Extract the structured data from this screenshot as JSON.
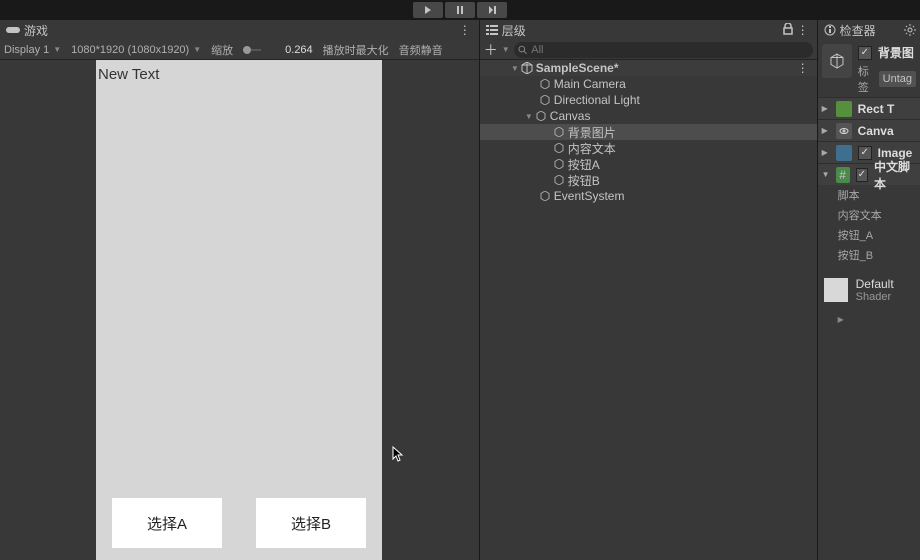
{
  "topbar": {},
  "game": {
    "tab_label": "游戏",
    "display_label": "Display 1",
    "resolution": "1080*1920 (1080x1920)",
    "zoom_label": "缩放",
    "zoom_value": "0.264",
    "maximize_label": "播放时最大化",
    "audio_label": "音频静音",
    "viewport": {
      "new_text": "New Text",
      "button_a": "选择A",
      "button_b": "选择B"
    }
  },
  "hierarchy": {
    "tab_label": "层级",
    "search_placeholder": "All",
    "scene": "SampleScene*",
    "items": [
      "Main Camera",
      "Directional Light",
      "Canvas",
      "背景图片",
      "内容文本",
      "按钮A",
      "按钮B",
      "EventSystem"
    ]
  },
  "inspector": {
    "tab_label": "检查器",
    "obj_name": "背景图",
    "tag_label": "标签",
    "tag_value": "Untag",
    "components": {
      "rect": "Rect T",
      "canvas": "Canva",
      "image": "Image",
      "script": "中文脚本"
    },
    "fields": {
      "script": "脚本",
      "content_text": "内容文本",
      "btn_a": "按钮_A",
      "btn_b": "按钮_B"
    },
    "material": {
      "name": "Default",
      "shader": "Shader"
    }
  }
}
